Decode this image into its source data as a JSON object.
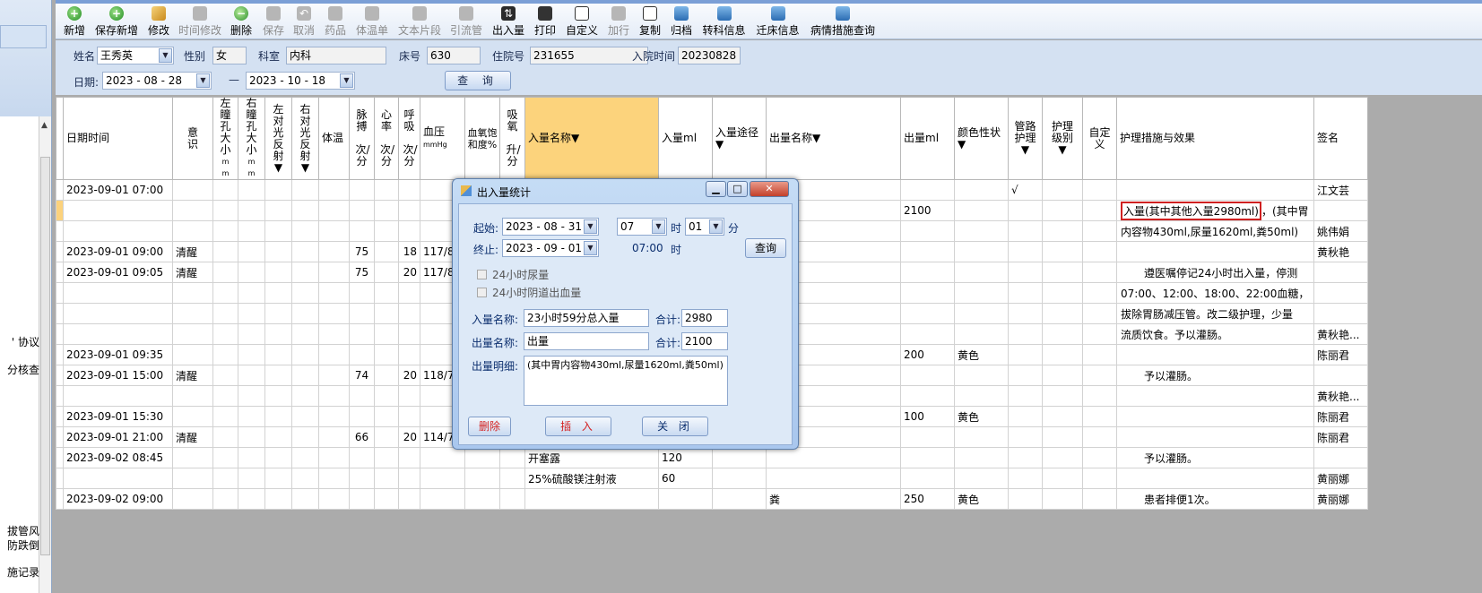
{
  "left_panel": {
    "fragments": [
      "' 协议",
      "分核查",
      "拔管风",
      "防跌倒",
      "施记录"
    ]
  },
  "toolbar": {
    "buttons": [
      {
        "label": "新增",
        "icon": "add-icon"
      },
      {
        "label": "保存新增",
        "icon": "add-icon"
      },
      {
        "label": "修改",
        "icon": "edit-icon"
      },
      {
        "label": "时间修改",
        "icon": "clock-icon"
      },
      {
        "label": "删除",
        "icon": "minus-icon"
      },
      {
        "label": "保存",
        "icon": "save-icon"
      },
      {
        "label": "取消",
        "icon": "undo-icon"
      },
      {
        "label": "药品",
        "icon": "medicine-icon"
      },
      {
        "label": "体温单",
        "icon": "chart-icon"
      },
      {
        "label": "文本片段",
        "icon": "text-icon"
      },
      {
        "label": "引流管",
        "icon": "tube-icon"
      },
      {
        "label": "出入量",
        "icon": "io-icon"
      },
      {
        "label": "打印",
        "icon": "print-icon"
      },
      {
        "label": "自定义",
        "icon": "document-icon"
      },
      {
        "label": "加行",
        "icon": "add-row-icon"
      },
      {
        "label": "复制",
        "icon": "copy-icon"
      },
      {
        "label": "归档",
        "icon": "archive-icon"
      },
      {
        "label": "转科信息",
        "icon": "clipboard-icon"
      },
      {
        "label": "迁床信息",
        "icon": "clipboard-icon"
      },
      {
        "label": "病情措施查询",
        "icon": "clipboard-icon"
      }
    ]
  },
  "patient": {
    "name_label": "姓名",
    "name": "王秀英",
    "sex_label": "性别",
    "sex": "女",
    "dept_label": "科室",
    "dept": "内科",
    "bed_label": "床号",
    "bed": "630",
    "inpatient_label": "住院号",
    "inpatient_no": "231655",
    "admit_label": "入院时间",
    "admit_date": "20230828"
  },
  "filter": {
    "date_label": "日期:",
    "start_date": "2023 - 08 - 28",
    "dash": "—",
    "end_date": "2023 - 10 - 18",
    "query_label": "查 询"
  },
  "grid": {
    "headers": {
      "datetime": "日期时间",
      "consciousness": "意识",
      "left_pupil": "左瞳孔大小",
      "left_pupil_unit": "mm",
      "right_pupil": "右瞳孔大小",
      "right_pupil_unit": "mm",
      "left_reflex": "左对光反射▼",
      "right_reflex": "右对光反射▼",
      "temp": "体温",
      "pulse": "脉搏",
      "pulse_unit": "次/分",
      "heart": "心率",
      "heart_unit": "次/分",
      "resp": "呼吸",
      "resp_unit": "次/分",
      "bp": "血压",
      "bp_unit": "mmHg",
      "spo2": "血氧饱和度%",
      "oxygen": "吸氧",
      "oxygen_unit": "升/分",
      "intake_name": "入量名称▼",
      "intake_ml": "入量ml",
      "intake_route": "入量途径▼",
      "output_name": "出量名称▼",
      "output_ml": "出量ml",
      "color": "颜色性状▼",
      "pipe_care": "管路护理▼",
      "care_level": "护理级别▼",
      "custom": "自定义",
      "measures": "护理措施与效果",
      "sign": "签名"
    },
    "rows": [
      {
        "dt": "2023-09-01 07:00",
        "con": "",
        "pulse": "",
        "resp": "",
        "bp": "",
        "in_name": "",
        "in_ml": "",
        "out_name": "",
        "out_ml": "",
        "color": "",
        "pipe": "√",
        "note": "",
        "sign": "江文芸"
      },
      {
        "dt": "",
        "con": "",
        "pulse": "",
        "resp": "",
        "bp": "",
        "in_name": "",
        "in_ml": "",
        "out_name": "",
        "out_ml": "2100",
        "color": "",
        "pipe": "",
        "note": "",
        "sign": ""
      },
      {
        "dt": "",
        "con": "",
        "pulse": "",
        "resp": "",
        "bp": "",
        "in_name": "",
        "in_ml": "",
        "out_name": "",
        "out_ml": "",
        "color": "",
        "pipe": "",
        "note": "内容物430ml,尿量1620ml,粪50ml)",
        "sign": "姚伟娟"
      },
      {
        "dt": "2023-09-01 09:00",
        "con": "清醒",
        "pulse": "75",
        "resp": "18",
        "bp": "117/83",
        "in_name": "",
        "in_ml": "",
        "out_name": "",
        "out_ml": "",
        "color": "",
        "pipe": "",
        "note": "",
        "sign": "黄秋艳"
      },
      {
        "dt": "2023-09-01 09:05",
        "con": "清醒",
        "pulse": "75",
        "resp": "20",
        "bp": "117/83",
        "in_name": "",
        "in_ml": "",
        "out_name": "",
        "out_ml": "",
        "color": "",
        "pipe": "",
        "note": "遵医嘱停记24小时出入量，停测",
        "sign": ""
      },
      {
        "dt": "",
        "con": "",
        "pulse": "",
        "resp": "",
        "bp": "",
        "in_name": "",
        "in_ml": "",
        "out_name": "",
        "out_ml": "",
        "color": "",
        "pipe": "",
        "note": "07:00、12:00、18:00、22:00血糖，",
        "sign": ""
      },
      {
        "dt": "",
        "con": "",
        "pulse": "",
        "resp": "",
        "bp": "",
        "in_name": "",
        "in_ml": "",
        "out_name": "",
        "out_ml": "",
        "color": "",
        "pipe": "",
        "note": "拔除胃肠减压管。改二级护理，少量",
        "sign": ""
      },
      {
        "dt": "",
        "con": "",
        "pulse": "",
        "resp": "",
        "bp": "",
        "in_name": "",
        "in_ml": "",
        "out_name": "",
        "out_ml": "",
        "color": "",
        "pipe": "",
        "note": "流质饮食。予以灌肠。",
        "sign": "黄秋艳..."
      },
      {
        "dt": "2023-09-01 09:35",
        "con": "",
        "pulse": "",
        "resp": "",
        "bp": "",
        "in_name": "",
        "in_ml": "",
        "out_name": "",
        "out_ml": "200",
        "color": "黄色",
        "pipe": "",
        "note": "",
        "sign": "陈丽君"
      },
      {
        "dt": "2023-09-01 15:00",
        "con": "清醒",
        "pulse": "74",
        "resp": "20",
        "bp": "118/70",
        "in_name": "",
        "in_ml": "",
        "out_name": "",
        "out_ml": "",
        "color": "",
        "pipe": "",
        "note": "予以灌肠。",
        "sign": ""
      },
      {
        "dt": "",
        "con": "",
        "pulse": "",
        "resp": "",
        "bp": "",
        "in_name": "",
        "in_ml": "",
        "out_name": "",
        "out_ml": "",
        "color": "",
        "pipe": "",
        "note": "",
        "sign": "黄秋艳..."
      },
      {
        "dt": "2023-09-01 15:30",
        "con": "",
        "pulse": "",
        "resp": "",
        "bp": "",
        "in_name": "",
        "in_ml": "",
        "out_name": "",
        "out_ml": "100",
        "color": "黄色",
        "pipe": "",
        "note": "",
        "sign": "陈丽君"
      },
      {
        "dt": "2023-09-01 21:00",
        "con": "清醒",
        "pulse": "66",
        "resp": "20",
        "bp": "114/76",
        "in_name": "",
        "in_ml": "",
        "out_name": "",
        "out_ml": "",
        "color": "",
        "pipe": "",
        "note": "",
        "sign": "陈丽君"
      },
      {
        "dt": "2023-09-02 08:45",
        "con": "",
        "pulse": "",
        "resp": "",
        "bp": "",
        "in_name": "开塞露",
        "in_ml": "120",
        "out_name": "",
        "out_ml": "",
        "color": "",
        "pipe": "",
        "note": "予以灌肠。",
        "sign": ""
      },
      {
        "dt": "",
        "con": "",
        "pulse": "",
        "resp": "",
        "bp": "",
        "in_name": "25%硫酸镁注射液",
        "in_ml": "60",
        "out_name": "",
        "out_ml": "",
        "color": "",
        "pipe": "",
        "note": "",
        "sign": "黄丽娜"
      },
      {
        "dt": "2023-09-02 09:00",
        "con": "",
        "pulse": "",
        "resp": "",
        "bp": "",
        "in_name": "",
        "in_ml": "",
        "out_name": "粪",
        "out_ml": "250",
        "color": "黄色",
        "pipe": "",
        "note": "患者排便1次。",
        "sign": "黄丽娜"
      }
    ],
    "row2_note_boxed": "入量(其中其他入量2980ml)",
    "row2_note_rest": "，(其中胃"
  },
  "dialog": {
    "title": "出入量统计",
    "start_label": "起始:",
    "start_date": "2023 - 08 - 31",
    "start_hour": "07",
    "hour_label": "时",
    "start_min": "01",
    "min_label": "分",
    "end_label": "终止:",
    "end_date": "2023 - 09 - 01",
    "end_time": "07:00",
    "end_hour_label": "时",
    "query_label": "查询",
    "check_urine": "24小时尿量",
    "check_bleeding": "24小时阴道出血量",
    "intake_label": "入量名称:",
    "intake_value": "23小时59分总入量",
    "intake_total_label": "合计:",
    "intake_total": "2980",
    "output_label": "出量名称:",
    "output_value": "出量",
    "output_total_label": "合计:",
    "output_total": "2100",
    "detail_label": "出量明细:",
    "detail_value": "(其中胃内容物430ml,尿量1620ml,粪50ml)",
    "delete_label": "删除",
    "insert_label": "插 入",
    "close_label": "关 闭"
  }
}
